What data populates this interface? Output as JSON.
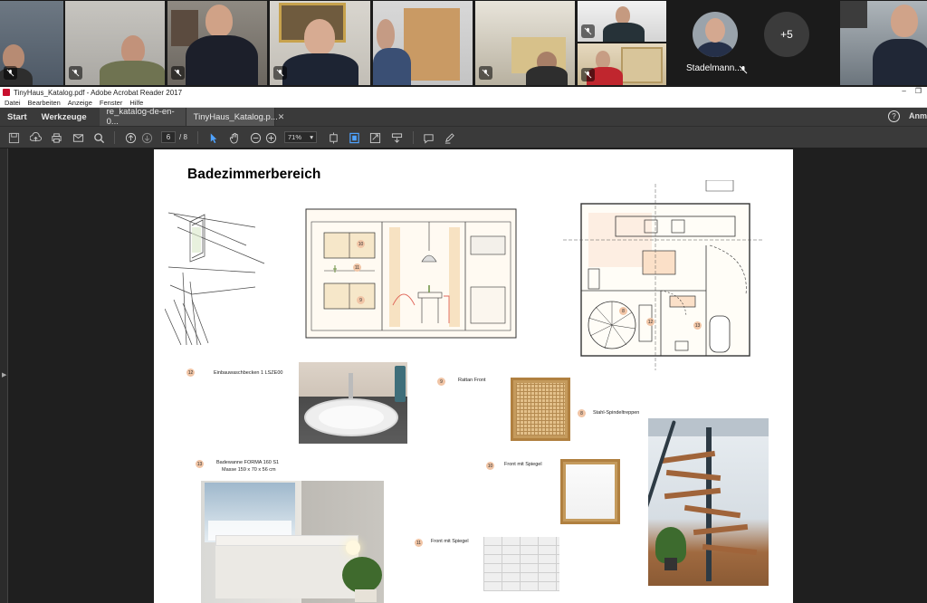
{
  "participants": {
    "avatar_name": "Stadelmann...",
    "overflow_label": "+5"
  },
  "window": {
    "title": "TinyHaus_Katalog.pdf - Adobe Acrobat Reader 2017"
  },
  "menu": [
    "Datei",
    "Bearbeiten",
    "Anzeige",
    "Fenster",
    "Hilfe"
  ],
  "tabs": {
    "home": "Start",
    "tools": "Werkzeuge",
    "doc1": "re_katalog-de-en-0...",
    "doc2": "TinyHaus_Katalog.p...",
    "signin": "Anm"
  },
  "toolbar": {
    "page_current": "6",
    "page_total": "/ 8",
    "zoom": "71%"
  },
  "pdf": {
    "heading": "Badezimmerbereich",
    "items": [
      {
        "num": "12",
        "text": "Einbauwaschbecken 1 LSZE00"
      },
      {
        "num": "9",
        "text": "Rattan Front"
      },
      {
        "num": "8",
        "text": "Stahl-Spindeltreppen"
      },
      {
        "num": "13",
        "text": "Badewanne FORMA 160 S1"
      },
      {
        "num": "13b",
        "text": "Masse 159 x 70 x 56 cm"
      },
      {
        "num": "10",
        "text": "Front mit Spiegel"
      },
      {
        "num": "11",
        "text": "Front mit Spiegel"
      }
    ],
    "sketch_labels": [
      "10",
      "11",
      "9",
      "8",
      "12",
      "13"
    ]
  },
  "colors": {
    "accent_active": "#5b6ad8",
    "acrobat_dark": "#3a3a3a",
    "number_badge": "#f1c5a6"
  }
}
